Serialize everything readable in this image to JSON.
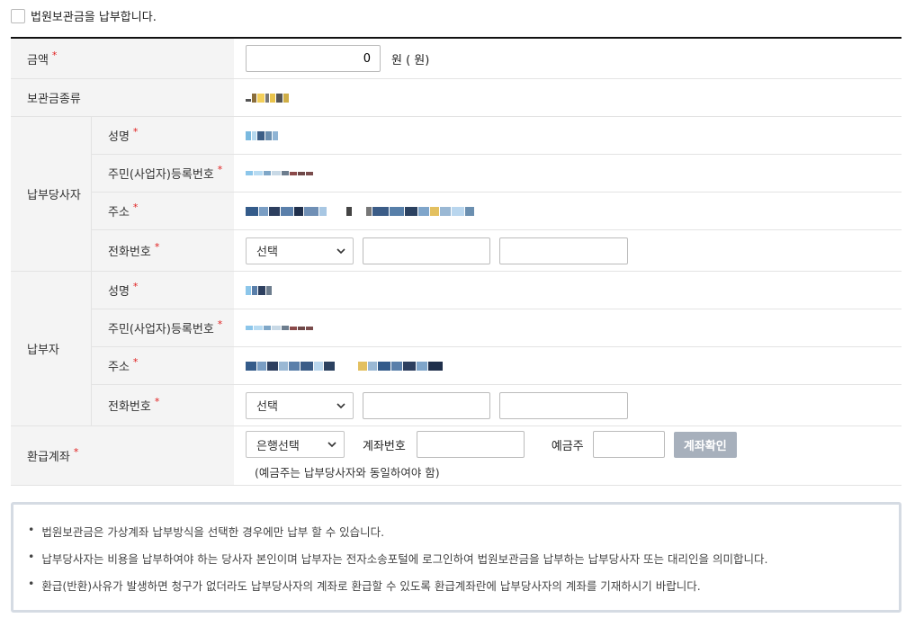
{
  "consent": {
    "label": "법원보관금을 납부합니다."
  },
  "amount": {
    "label": "금액",
    "value": "0",
    "unit": "원 ( 원)"
  },
  "deposit_type": {
    "label": "보관금종류"
  },
  "payer_party": {
    "label": "납부당사자",
    "name_label": "성명",
    "regno_label": "주민(사업자)등록번호",
    "address_label": "주소",
    "phone_label": "전화번호",
    "phone_select": "선택"
  },
  "payer": {
    "label": "납부자",
    "name_label": "성명",
    "regno_label": "주민(사업자)등록번호",
    "address_label": "주소",
    "phone_label": "전화번호",
    "phone_select": "선택"
  },
  "refund": {
    "label": "환급계좌",
    "bank_select": "은행선택",
    "account_label": "계좌번호",
    "holder_label": "예금주",
    "confirm_button": "계좌확인",
    "note": "(예금주는 납부당사자와 동일하여야 함)"
  },
  "notices": [
    "법원보관금은 가상계좌 납부방식을 선택한 경우에만 납부 할 수 있습니다.",
    "납부당사자는 비용을 납부하여야 하는 당사자 본인이며 납부자는 전자소송포털에 로그인하여 법원보관금을 납부하는 납부당사자 또는 대리인을 의미합니다.",
    "환급(반환)사유가 발생하면 청구가 없더라도 납부당사자의 계좌로 환급할 수 있도록 환급계좌란에 납부당사자의 계좌를 기재하시기 바랍니다."
  ],
  "colors": {
    "required": "#e02020",
    "label_bg": "#f4f4f4",
    "button_disabled": "#a7b0bc"
  },
  "icons": {
    "select_arrow": "chevron-down-icon",
    "checkbox": "checkbox-icon"
  }
}
